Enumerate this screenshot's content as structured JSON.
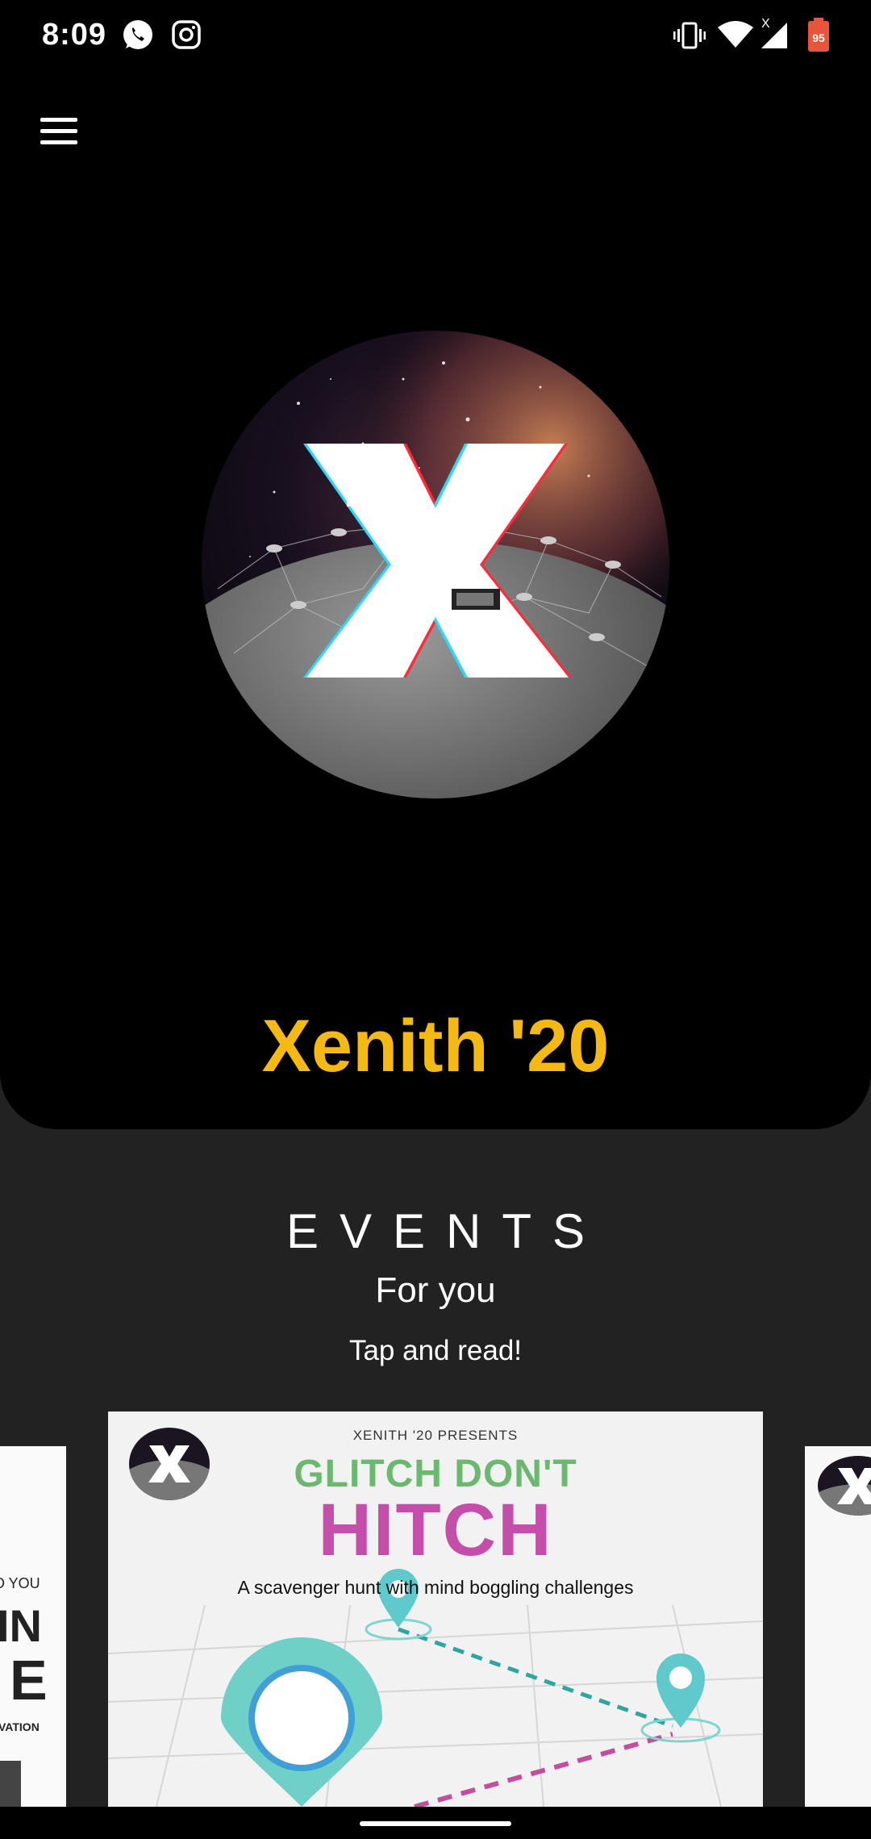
{
  "status_bar": {
    "time": "8:09",
    "battery_level": "95",
    "icons": [
      "whatsapp-icon",
      "instagram-icon",
      "vibrate-icon",
      "wifi-icon",
      "signal-icon",
      "battery-icon"
    ]
  },
  "header": {
    "menu_icon": "hamburger-menu-icon"
  },
  "hero": {
    "title": "Xenith '20",
    "title_color": "#F5B913"
  },
  "events": {
    "heading": "EVENTS",
    "subheading": "For you",
    "hint": "Tap and read!"
  },
  "carousel": {
    "main_card": {
      "presents": "XENITH '20 PRESENTS",
      "title_line1": "GLITCH DON'T",
      "title_line2": "HITCH",
      "tagline": "A scavenger hunt with mind boggling challenges"
    },
    "left_card": {
      "line1": "O YOU",
      "line2": "IN",
      "line3": "E",
      "line4": "VATION"
    }
  }
}
